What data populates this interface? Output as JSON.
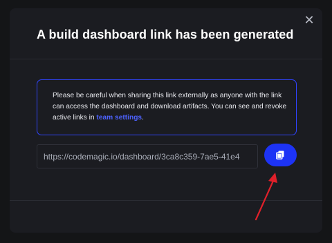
{
  "modal": {
    "title": "A build dashboard link has been generated",
    "close_icon": "close-icon",
    "notice": {
      "text_before_link": "Please be careful when sharing this link externally as anyone with the link can access the dashboard and download artifacts. You can see and revoke active links in ",
      "link_text": "team settings",
      "text_after_link": "."
    },
    "url_field": {
      "value": "https://codemagic.io/dashboard/3ca8c359-7ae5-41e4"
    },
    "copy_button": {
      "icon": "copy-icon"
    }
  },
  "colors": {
    "background": "#141517",
    "modal": "#1b1c21",
    "accent": "#1d33f5",
    "link": "#4d62ff",
    "annotation_arrow": "#e0202a"
  }
}
